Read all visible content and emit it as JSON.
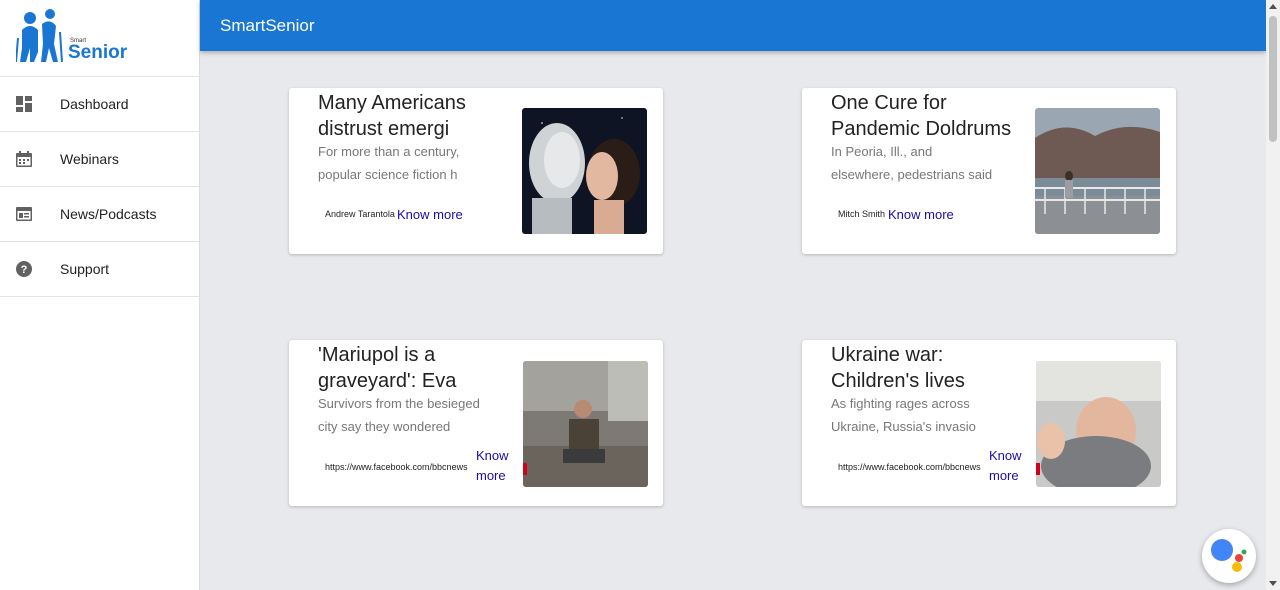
{
  "brand": {
    "logo_small": "Smart",
    "logo_large": "Senior",
    "app_title": "SmartSenior",
    "color_primary": "#1976d2"
  },
  "sidebar": {
    "items": [
      {
        "label": "Dashboard",
        "icon": "dashboard-icon"
      },
      {
        "label": "Webinars",
        "icon": "calendar-icon"
      },
      {
        "label": "News/Podcasts",
        "icon": "newspaper-icon"
      },
      {
        "label": "Support",
        "icon": "help-icon"
      }
    ]
  },
  "articles": [
    {
      "headline": "Many Americans distrust emergi",
      "description": "For more than a century, popular science fiction h",
      "author": "Andrew Tarantola",
      "link_label": "Know more",
      "image": "robot-and-woman-photo"
    },
    {
      "headline": "One Cure for Pandemic Doldrums",
      "description": "In Peoria, Ill., and elsewhere, pedestrians said t",
      "author": "Mitch Smith",
      "link_label": "Know more",
      "image": "riverside-walkway-photo"
    },
    {
      "headline": "'Mariupol is a graveyard': Eva",
      "description": "Survivors from the besieged city say they wondered",
      "author": "https://www.facebook.com/bbcnews",
      "link_label": "Know more",
      "image": "man-sitting-in-rubble-photo"
    },
    {
      "headline": "Ukraine war: Children's lives",
      "description": "As fighting rages across Ukraine, Russia's invasio",
      "author": "https://www.facebook.com/bbcnews",
      "link_label": "Know more",
      "image": "child-in-hospital-photo"
    }
  ]
}
